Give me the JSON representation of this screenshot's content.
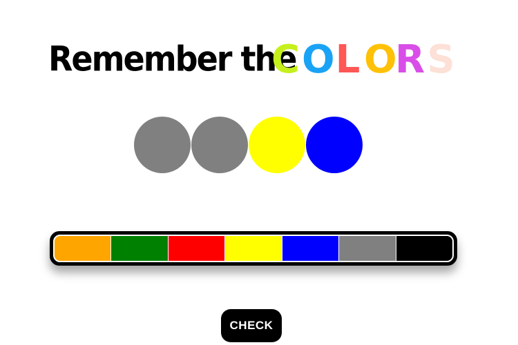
{
  "title": {
    "part1": "Remember the",
    "colors_word": [
      {
        "letter": "C",
        "color": "#c6f01b"
      },
      {
        "letter": "O",
        "color": "#1aa3f5"
      },
      {
        "letter": "L",
        "color": "#ff5656"
      },
      {
        "letter": "O",
        "color": "#ffc107"
      },
      {
        "letter": "R",
        "color": "#d94ee8"
      },
      {
        "letter": "S",
        "color": "#fde0d6"
      }
    ]
  },
  "sequence": [
    {
      "state": "hidden",
      "color": "#808080"
    },
    {
      "state": "hidden",
      "color": "#808080"
    },
    {
      "state": "revealed",
      "color": "#ffff00"
    },
    {
      "state": "revealed",
      "color": "#0000ff"
    }
  ],
  "palette": [
    {
      "name": "orange",
      "color": "#ffa500"
    },
    {
      "name": "green",
      "color": "#008000"
    },
    {
      "name": "red",
      "color": "#ff0000"
    },
    {
      "name": "yellow",
      "color": "#ffff00"
    },
    {
      "name": "blue",
      "color": "#0000ff"
    },
    {
      "name": "gray",
      "color": "#808080"
    },
    {
      "name": "black",
      "color": "#000000"
    }
  ],
  "check_button": {
    "label": "CHECK"
  }
}
